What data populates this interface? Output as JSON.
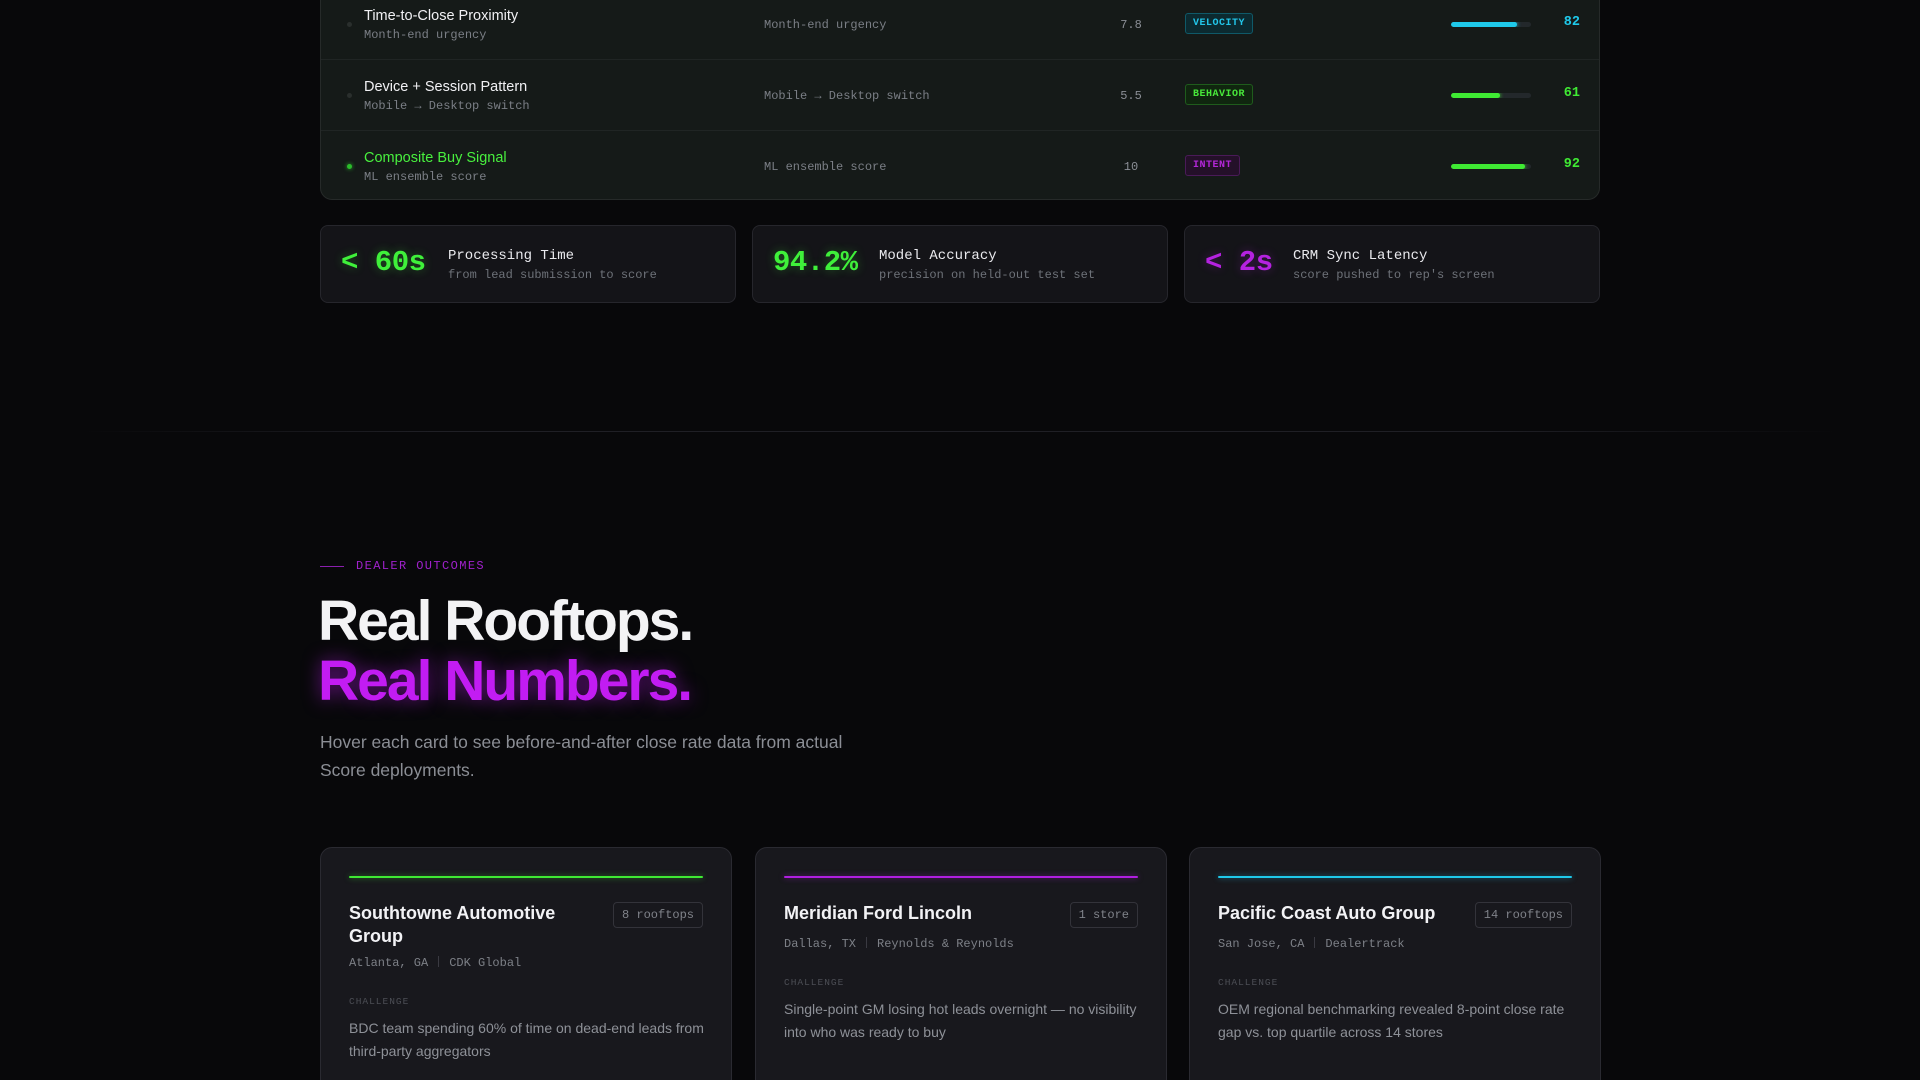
{
  "signals": [
    {
      "name": "Time-to-Close Proximity",
      "sub": "Month-end urgency",
      "description": "Month-end urgency",
      "weight": "7.8",
      "tag": "VELOCITY",
      "tag_style": "velocity",
      "score": "82",
      "score_value": 82,
      "color": "#1fc9ea",
      "active": false
    },
    {
      "name": "Device + Session Pattern",
      "sub": "Mobile → Desktop switch",
      "description": "Mobile → Desktop switch",
      "weight": "5.5",
      "tag": "BEHAVIOR",
      "tag_style": "behavior",
      "score": "61",
      "score_value": 61,
      "color": "#3fea33",
      "active": false
    },
    {
      "name": "Composite Buy Signal",
      "sub": "ML ensemble score",
      "description": "ML ensemble score",
      "weight": "10",
      "tag": "INTENT",
      "tag_style": "intent",
      "score": "92",
      "score_value": 92,
      "color": "#3fea33",
      "active": true
    }
  ],
  "metrics": [
    {
      "value": "< 60s",
      "label": "Processing Time",
      "sub": "from lead submission to score",
      "color": "#3ff03a"
    },
    {
      "value": "94.2%",
      "label": "Model Accuracy",
      "sub": "precision on held-out test set",
      "color": "#3ff03a"
    },
    {
      "value": "< 2s",
      "label": "CRM Sync Latency",
      "sub": "score pushed to rep's screen",
      "color": "#b522e0"
    }
  ],
  "outcomes": {
    "eyebrow": "DEALER OUTCOMES",
    "headline_1": "Real Rooftops.",
    "headline_2": "Real Numbers.",
    "lead": "Hover each card to see before-and-after close rate data from actual Score deployments."
  },
  "dealers": [
    {
      "name": "Southtowne Automotive Group",
      "count": "8 rooftops",
      "location": "Atlanta, GA",
      "dms": "CDK Global",
      "challenge_label": "CHALLENGE",
      "challenge": "BDC team spending 60% of time on dead-end leads from third-party aggregators",
      "accent": "#3fea33"
    },
    {
      "name": "Meridian Ford Lincoln",
      "count": "1 store",
      "location": "Dallas, TX",
      "dms": "Reynolds & Reynolds",
      "challenge_label": "CHALLENGE",
      "challenge": "Single-point GM losing hot leads overnight — no visibility into who was ready to buy",
      "accent": "#b01fe0"
    },
    {
      "name": "Pacific Coast Auto Group",
      "count": "14 rooftops",
      "location": "San Jose, CA",
      "dms": "Dealertrack",
      "challenge_label": "CHALLENGE",
      "challenge": "OEM regional benchmarking revealed 8-point close rate gap vs. top quartile across 14 stores",
      "accent": "#1fc9ea"
    }
  ]
}
